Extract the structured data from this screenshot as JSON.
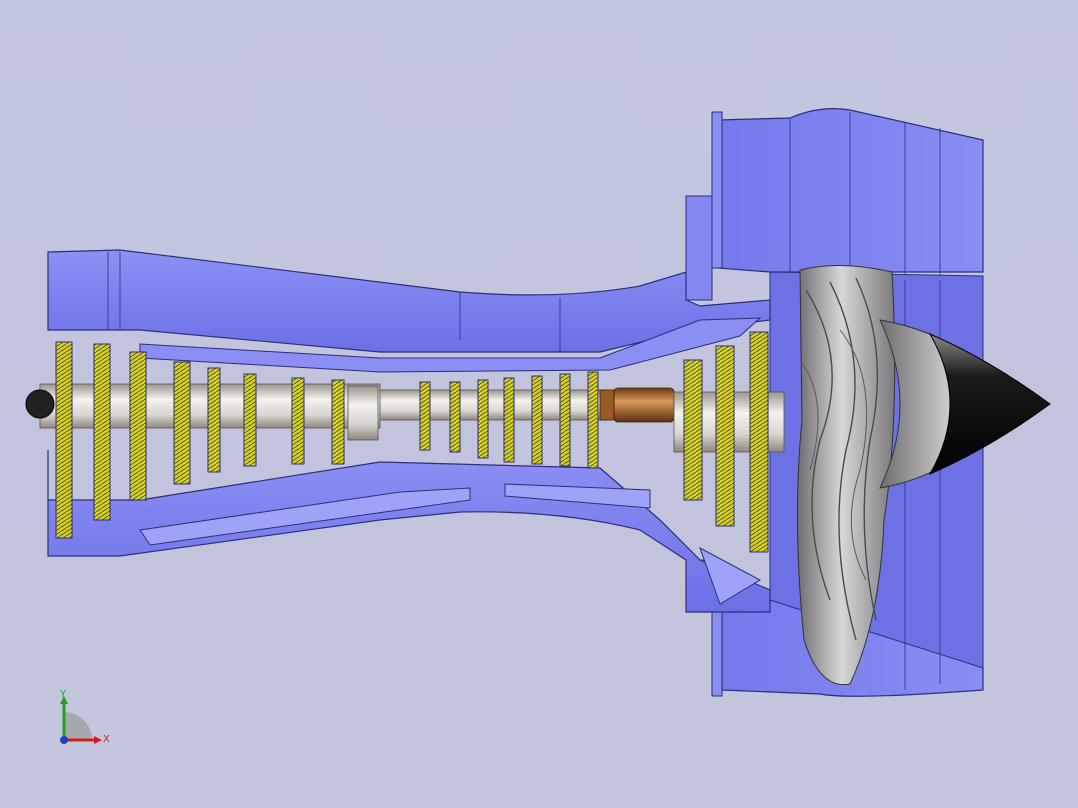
{
  "viewport": {
    "background": "#c3c6df",
    "model": "turbofan-engine-section-view",
    "colors": {
      "casing": "#7b7ff0",
      "casing_light": "#a9acf7",
      "casing_edge": "#2a2f7a",
      "blade": "#d6d32c",
      "shaft": "#e6e3df",
      "bearing": "#b06a2a",
      "fan_blade": "#a9a9ac",
      "spinner": "#111111"
    }
  },
  "triad": {
    "x_label": "X",
    "y_label": "Y",
    "x_color": "#d21d1d",
    "y_color": "#1fa31f",
    "z_color": "#1f3fc8"
  }
}
